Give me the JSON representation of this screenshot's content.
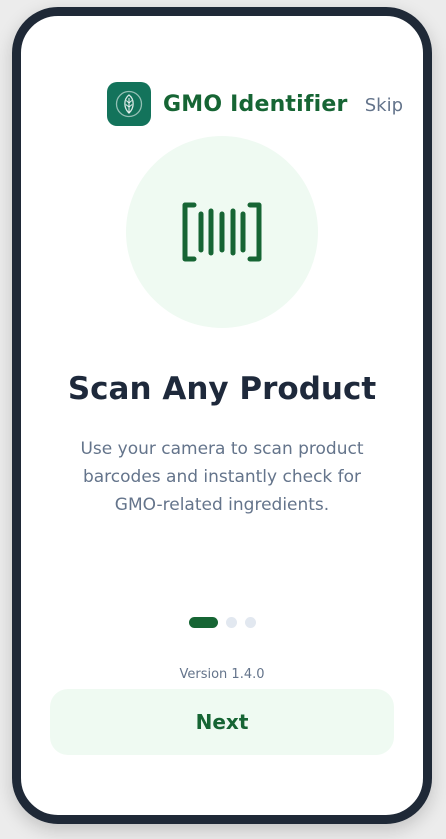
{
  "app": {
    "name": "GMO Identifier",
    "logo_icon": "leaf-icon"
  },
  "header": {
    "skip_label": "Skip"
  },
  "slide": {
    "icon": "barcode-scan-icon",
    "title": "Scan Any Product",
    "description": "Use your camera to scan product barcodes and instantly check for GMO-related ingredients."
  },
  "pagination": {
    "total": 3,
    "current": 1
  },
  "footer": {
    "version": "Version 1.4.0",
    "next_label": "Next"
  },
  "colors": {
    "brand_green": "#166534",
    "logo_bg": "#13735b",
    "hero_bg": "#effaf2",
    "title": "#1e293b",
    "muted": "#64748b",
    "frame": "#1f2937"
  }
}
